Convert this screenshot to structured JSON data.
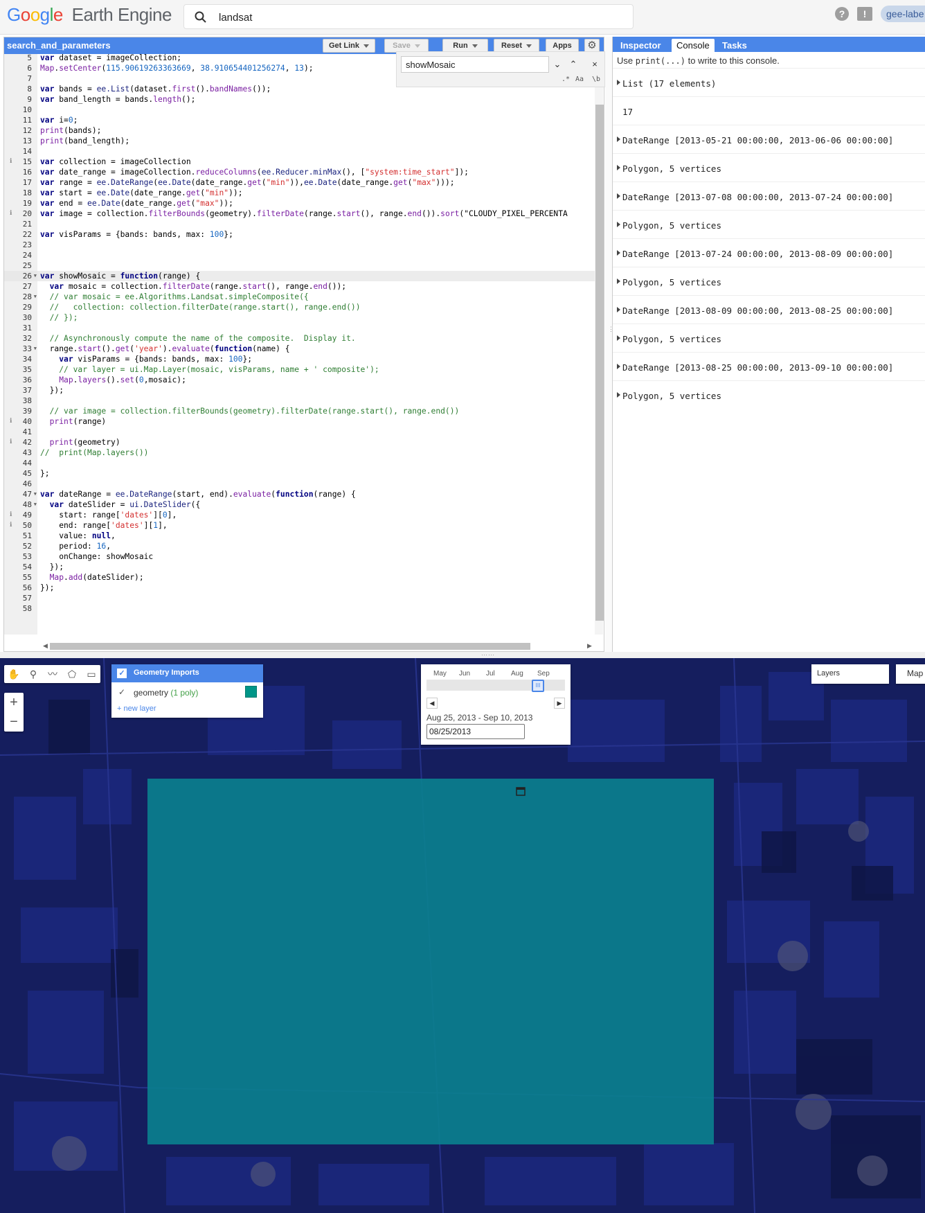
{
  "app": {
    "logo_google": "Google",
    "logo_product": "Earth Engine",
    "search_value": "landsat",
    "help_glyph": "?",
    "feedback_glyph": "!",
    "user": "gee-labe"
  },
  "editor": {
    "script_name": "search_and_parameters",
    "buttons": {
      "get_link": "Get Link",
      "save": "Save",
      "run": "Run",
      "reset": "Reset",
      "apps": "Apps"
    },
    "find": {
      "value": "showMosaic",
      "opt_regex": ".*",
      "opt_case": "Aa",
      "opt_word": "\\b"
    },
    "lines": [
      {
        "n": "5",
        "text": "var dataset = imageCollection;"
      },
      {
        "n": "6",
        "text": "Map.setCenter(115.90619263363669, 38.910654401256274, 13);"
      },
      {
        "n": "7",
        "text": ""
      },
      {
        "n": "8",
        "text": "var bands = ee.List(dataset.first().bandNames());"
      },
      {
        "n": "9",
        "text": "var band_length = bands.length();"
      },
      {
        "n": "10",
        "text": ""
      },
      {
        "n": "11",
        "text": "var i=0;"
      },
      {
        "n": "12",
        "text": "print(bands);"
      },
      {
        "n": "13",
        "text": "print(band_length);"
      },
      {
        "n": "14",
        "text": ""
      },
      {
        "n": "15",
        "text": "var collection = imageCollection",
        "info": true
      },
      {
        "n": "16",
        "text": "var date_range = imageCollection.reduceColumns(ee.Reducer.minMax(), [\"system:time_start\"]);"
      },
      {
        "n": "17",
        "text": "var range = ee.DateRange(ee.Date(date_range.get(\"min\")),ee.Date(date_range.get(\"max\")));"
      },
      {
        "n": "18",
        "text": "var start = ee.Date(date_range.get(\"min\"));"
      },
      {
        "n": "19",
        "text": "var end = ee.Date(date_range.get(\"max\"));"
      },
      {
        "n": "20",
        "text": "var image = collection.filterBounds(geometry).filterDate(range.start(), range.end()).sort(\"CLOUDY_PIXEL_PERCENTA",
        "info": true
      },
      {
        "n": "21",
        "text": ""
      },
      {
        "n": "22",
        "text": "var visParams = {bands: bands, max: 100};"
      },
      {
        "n": "23",
        "text": ""
      },
      {
        "n": "24",
        "text": ""
      },
      {
        "n": "25",
        "text": ""
      },
      {
        "n": "26",
        "text": "var showMosaic = function(range) {",
        "fold": true,
        "current": true
      },
      {
        "n": "27",
        "text": "  var mosaic = collection.filterDate(range.start(), range.end());"
      },
      {
        "n": "28",
        "text": "  // var mosaic = ee.Algorithms.Landsat.simpleComposite({",
        "fold": true
      },
      {
        "n": "29",
        "text": "  //   collection: collection.filterDate(range.start(), range.end())"
      },
      {
        "n": "30",
        "text": "  // });"
      },
      {
        "n": "31",
        "text": ""
      },
      {
        "n": "32",
        "text": "  // Asynchronously compute the name of the composite.  Display it."
      },
      {
        "n": "33",
        "text": "  range.start().get('year').evaluate(function(name) {",
        "fold": true
      },
      {
        "n": "34",
        "text": "    var visParams = {bands: bands, max: 100};"
      },
      {
        "n": "35",
        "text": "    // var layer = ui.Map.Layer(mosaic, visParams, name + ' composite');"
      },
      {
        "n": "36",
        "text": "    Map.layers().set(0,mosaic);"
      },
      {
        "n": "37",
        "text": "  });"
      },
      {
        "n": "38",
        "text": ""
      },
      {
        "n": "39",
        "text": "  // var image = collection.filterBounds(geometry).filterDate(range.start(), range.end())"
      },
      {
        "n": "40",
        "text": "  print(range)",
        "info": true
      },
      {
        "n": "41",
        "text": ""
      },
      {
        "n": "42",
        "text": "  print(geometry)",
        "info": true
      },
      {
        "n": "43",
        "text": "//  print(Map.layers())"
      },
      {
        "n": "44",
        "text": ""
      },
      {
        "n": "45",
        "text": "};"
      },
      {
        "n": "46",
        "text": ""
      },
      {
        "n": "47",
        "text": "var dateRange = ee.DateRange(start, end).evaluate(function(range) {",
        "fold": true
      },
      {
        "n": "48",
        "text": "  var dateSlider = ui.DateSlider({",
        "fold": true
      },
      {
        "n": "49",
        "text": "    start: range['dates'][0],",
        "info": true
      },
      {
        "n": "50",
        "text": "    end: range['dates'][1],",
        "info": true
      },
      {
        "n": "51",
        "text": "    value: null,"
      },
      {
        "n": "52",
        "text": "    period: 16,"
      },
      {
        "n": "53",
        "text": "    onChange: showMosaic"
      },
      {
        "n": "54",
        "text": "  });"
      },
      {
        "n": "55",
        "text": "  Map.add(dateSlider);"
      },
      {
        "n": "56",
        "text": "});"
      },
      {
        "n": "57",
        "text": ""
      },
      {
        "n": "58",
        "text": ""
      }
    ]
  },
  "right_panel": {
    "tabs": [
      "Inspector",
      "Console",
      "Tasks"
    ],
    "active_tab": "Console",
    "hint_pre": "Use ",
    "hint_code": "print(...)",
    "hint_post": " to write to this console.",
    "entries": [
      {
        "text": "List (17 elements)",
        "expandable": true
      },
      {
        "text": "17",
        "expandable": false
      },
      {
        "text": "DateRange [2013-05-21 00:00:00, 2013-06-06 00:00:00]",
        "expandable": true
      },
      {
        "text": "Polygon, 5 vertices",
        "expandable": true
      },
      {
        "text": "DateRange [2013-07-08 00:00:00, 2013-07-24 00:00:00]",
        "expandable": true
      },
      {
        "text": "Polygon, 5 vertices",
        "expandable": true
      },
      {
        "text": "DateRange [2013-07-24 00:00:00, 2013-08-09 00:00:00]",
        "expandable": true
      },
      {
        "text": "Polygon, 5 vertices",
        "expandable": true
      },
      {
        "text": "DateRange [2013-08-09 00:00:00, 2013-08-25 00:00:00]",
        "expandable": true
      },
      {
        "text": "Polygon, 5 vertices",
        "expandable": true
      },
      {
        "text": "DateRange [2013-08-25 00:00:00, 2013-09-10 00:00:00]",
        "expandable": true
      },
      {
        "text": "Polygon, 5 vertices",
        "expandable": true
      }
    ]
  },
  "map": {
    "geometry_imports": {
      "title": "Geometry Imports",
      "layer_name": "geometry",
      "layer_count": "(1 poly)",
      "layer_color": "#009688",
      "new_layer": "+ new layer"
    },
    "date_slider": {
      "months": [
        "May",
        "Jun",
        "Jul",
        "Aug",
        "Sep"
      ],
      "range_label": "Aug 25, 2013 - Sep 10, 2013",
      "date_value": "08/25/2013",
      "thumb_glyph": "III"
    },
    "zoom_in": "+",
    "zoom_out": "−",
    "layers_label": "Layers",
    "map_type": "Map",
    "colors": {
      "imagery": "#141d5a",
      "polygon": "#0b7f8e",
      "accent": "#4a86e8"
    }
  }
}
